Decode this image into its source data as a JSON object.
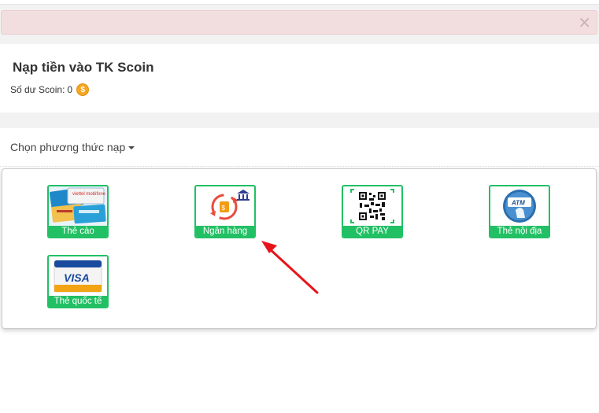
{
  "alert": {
    "close_symbol": "×"
  },
  "balance_card": {
    "title": "Nạp tiền vào TK Scoin",
    "balance_label": "Số dư Scoin:",
    "balance_value": "0",
    "coin_icon": "coin-icon"
  },
  "methods_card": {
    "header": "Chọn phương thức nạp",
    "tiles": [
      {
        "label": "Thẻ cào",
        "icon": "scratch-card-icon"
      },
      {
        "label": "Ngân hàng",
        "icon": "bank-transfer-icon"
      },
      {
        "label": "QR PAY",
        "icon": "qr-code-icon"
      },
      {
        "label": "Thẻ nội địa",
        "icon": "atm-card-icon"
      },
      {
        "label": "Thẻ quốc tế",
        "icon": "visa-card-icon"
      }
    ]
  },
  "colors": {
    "accent_green": "#22c064",
    "alert_bg": "#f2dede",
    "annotation_red": "#e8141b"
  },
  "annotation": {
    "icon": "red-arrow-icon"
  }
}
